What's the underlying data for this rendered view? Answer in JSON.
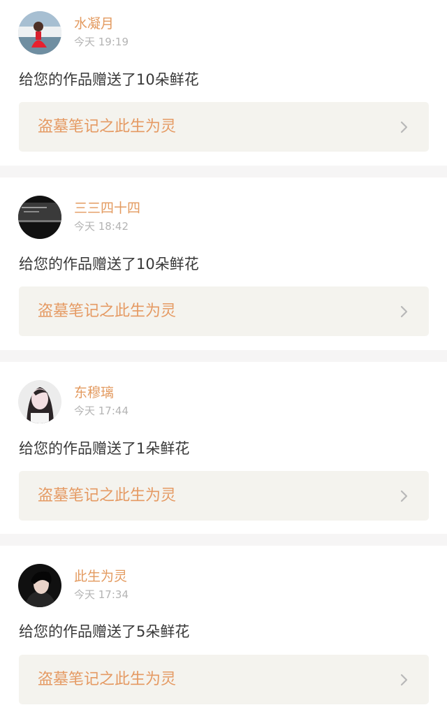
{
  "feed": {
    "items": [
      {
        "username": "水凝月",
        "time": "今天 19:19",
        "message": "给您的作品赠送了10朵鲜花",
        "work_title": "盗墓笔记之此生为灵"
      },
      {
        "username": "三三四十四",
        "time": "今天 18:42",
        "message": "给您的作品赠送了10朵鲜花",
        "work_title": "盗墓笔记之此生为灵"
      },
      {
        "username": "东穆璃",
        "time": "今天 17:44",
        "message": "给您的作品赠送了1朵鲜花",
        "work_title": "盗墓笔记之此生为灵"
      },
      {
        "username": "此生为灵",
        "time": "今天 17:34",
        "message": "给您的作品赠送了5朵鲜花",
        "work_title": "盗墓笔记之此生为灵"
      }
    ]
  },
  "colors": {
    "accent": "#e39a5f",
    "link_background": "#f4f3ee",
    "timestamp": "#b4b4b4",
    "message_text": "#383838",
    "separator": "#f6f5f5"
  },
  "icons": {
    "forward": "chevron-right-icon"
  }
}
